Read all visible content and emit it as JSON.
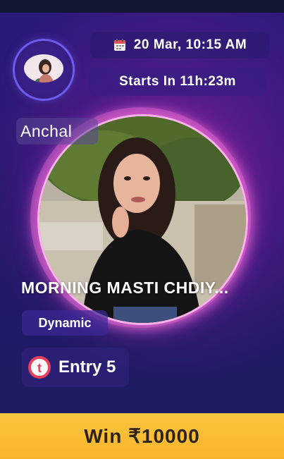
{
  "host": {
    "name": "Anchal"
  },
  "schedule": {
    "date_time": "20 Mar, 10:15 AM",
    "starts_in": "Starts In 11h:23m"
  },
  "event": {
    "title": "MORNING MASTI CHDIY...",
    "type": "Dynamic"
  },
  "entry": {
    "label": "Entry 5"
  },
  "prize": {
    "label": "Win ₹10000"
  },
  "icons": {
    "calendar": "calendar-icon",
    "ticket": "ticket-icon"
  },
  "colors": {
    "win_bar": "#f8b52c",
    "ring_glow": "#ff7adb",
    "avatar_ring": "#6d5cf0",
    "background": "#25186c"
  }
}
